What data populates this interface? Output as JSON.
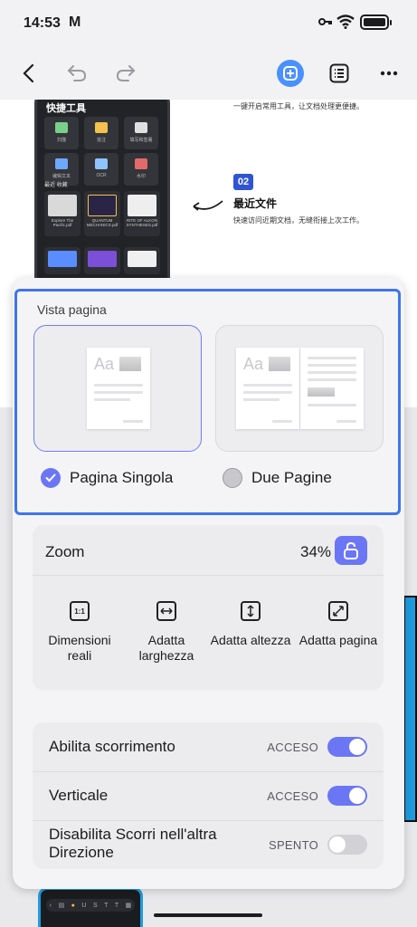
{
  "status": {
    "time": "14:53",
    "mail_icon": "M"
  },
  "toolbar": {
    "back_icon": "chevron-left-icon",
    "undo_icon": "undo-icon",
    "redo_icon": "redo-icon",
    "ai_icon": "ai-assistant-icon",
    "outline_icon": "list-icon",
    "more_icon": "more-horizontal-icon"
  },
  "document": {
    "phone_title": "快捷工具",
    "tools": [
      "扫描",
      "批注",
      "填写和签署",
      "编辑文本",
      "OCR",
      "水印"
    ],
    "tabs": "最近   收藏",
    "files": [
      {
        "name": "Explore The Pacific.pdf"
      },
      {
        "name": "QUANTUM MECHANICS.pdf"
      },
      {
        "name": "RITE OF ALKON SYNTHESES.pdf"
      }
    ],
    "line1": "一键开启常用工具，让文档处理更便捷。",
    "badge": "02",
    "heading": "最近文件",
    "line2": "快速访问近期文档，无缝衔接上次工作。"
  },
  "view_panel": {
    "title": "Vista pagina",
    "single": {
      "label": "Pagina Singola",
      "selected": true
    },
    "double": {
      "label": "Due Pagine",
      "selected": false
    },
    "sample_text": "Aa"
  },
  "zoom": {
    "label": "Zoom",
    "value": "34%",
    "lock_icon": "unlock-icon",
    "fit": [
      {
        "label": "Dimensioni reali",
        "icon": "actual-size-icon",
        "icon_text": "1:1"
      },
      {
        "label": "Adatta larghezza",
        "icon": "fit-width-icon"
      },
      {
        "label": "Adatta altezza",
        "icon": "fit-height-icon"
      },
      {
        "label": "Adatta pagina",
        "icon": "fit-page-icon"
      }
    ]
  },
  "scroll": {
    "rows": [
      {
        "label": "Abilita scorrimento",
        "state": "ACCESO",
        "on": true
      },
      {
        "label": "Verticale",
        "state": "ACCESO",
        "on": true
      },
      {
        "label": "Disabilita Scorri nell'altra Direzione",
        "state": "SPENTO",
        "on": false
      }
    ]
  },
  "colors": {
    "accent": "#6b76f5",
    "highlight_border": "#3f74ec",
    "ai_blue": "#4a90ff"
  }
}
